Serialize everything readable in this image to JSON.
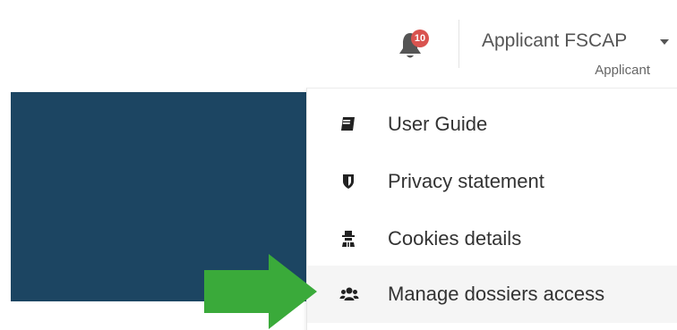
{
  "header": {
    "notifications": {
      "icon": "bell-icon",
      "count": "10",
      "badge_color": "#d9534f"
    },
    "user": {
      "name": "Applicant FSCAP",
      "role": "Applicant"
    }
  },
  "banner": {
    "color": "#1c4562"
  },
  "menu": {
    "items": [
      {
        "label": "User Guide",
        "icon": "book-icon"
      },
      {
        "label": "Privacy statement",
        "icon": "shield-icon"
      },
      {
        "label": "Cookies details",
        "icon": "user-secret-icon"
      },
      {
        "label": "Manage dossiers access",
        "icon": "users-icon"
      }
    ]
  },
  "annotation": {
    "arrow_color": "#3aaa3a",
    "arrow_target": "Manage dossiers access"
  }
}
